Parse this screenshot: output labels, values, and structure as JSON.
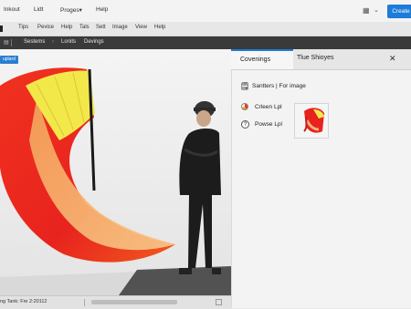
{
  "titlebar": {
    "menus": [
      "Inkout",
      "Lidt",
      "Proges▾",
      "Help"
    ],
    "create_label": "Create"
  },
  "menubar": {
    "items": [
      "Tips",
      "Pevice",
      "Help",
      "Tals",
      "Sett",
      "Image",
      "View",
      "Help"
    ]
  },
  "tabbar": {
    "tabs": [
      "Sestems",
      "Lonits",
      "Devings"
    ],
    "separator": "›"
  },
  "canvas": {
    "badge": "uplard"
  },
  "panel": {
    "tab_active": "Covenings",
    "tab_other": "Tlue Shioyes",
    "summary_label": "Santters",
    "summary_sep": "|",
    "summary_value": "For image",
    "rows": [
      "Crleen Lpl",
      "Powse Lpl"
    ],
    "row2_glyph": "?"
  },
  "statusbar": {
    "text": "ng Tank: Fre 2:20112"
  },
  "colors": {
    "accent": "#1e7bd8",
    "umbrella_red": "#e8231e",
    "umbrella_orange": "#f47a1e",
    "umbrella_yellow": "#f2e84a"
  }
}
